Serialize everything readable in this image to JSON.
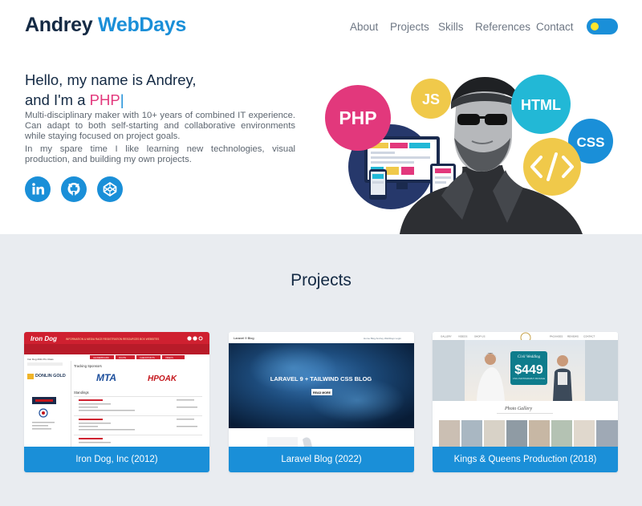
{
  "header": {
    "brand_first": "Andrey",
    "brand_second": "WebDays",
    "nav": [
      "About",
      "Projects",
      "Skills",
      "References",
      "Contact"
    ],
    "theme_toggle": "dark-mode-toggle"
  },
  "hero": {
    "line1": "Hello, my name is Andrey,",
    "line2_prefix": "and I'm a ",
    "line2_word": "PHP",
    "caret": "|",
    "para1": "Multi-disciplinary maker with 10+ years of combined IT experience. Can adapt to both self-starting and collaborative environments while staying focused on project goals.",
    "para2": "In my spare time I like learning new technologies, visual production, and building my own projects.",
    "social_icons": [
      "linkedin-icon",
      "github-icon",
      "codepen-icon"
    ],
    "bubbles": [
      "PHP",
      "JS",
      "HTML",
      "CSS"
    ]
  },
  "projects": {
    "title": "Projects",
    "items": [
      {
        "caption": "Iron Dog, Inc (2012)",
        "thumb": {
          "logo": "Iron Dog",
          "nav": "INFORMATION & MEDIA   RACE REGISTRATION RESOURCES   BOX WEBSITES",
          "tabs": [
            "LEADERBOARD",
            "ROUTE",
            "CHECKPOINTS",
            "VIDEOS"
          ],
          "side_title": "Iron Dog 2011 Pro Class",
          "sponsors_label": "Tracking Sponsors",
          "sponsor1": "MTA",
          "sponsor2": "HPOAK",
          "standings_label": "Standings",
          "left_logos": [
            "DONLIN GOLD"
          ]
        }
      },
      {
        "caption": "Laravel Blog (2022)",
        "thumb": {
          "site": "Laravel 9 Blog",
          "links": "Home   Blog   Andrey WebDays   Login",
          "banner": "LARAVEL 9 + TAILWIND CSS BLOG",
          "button": "READ MORE"
        }
      },
      {
        "caption": "Kings & Queens Production (2018)",
        "thumb": {
          "nav_left": [
            "GALLERY",
            "VIDEOS",
            "SHOP US"
          ],
          "nav_right": [
            "PACKAGES",
            "REVIEWS",
            "CONTACT"
          ],
          "script": "Civil Wedding",
          "price": "$449",
          "price_note": "CIVIL PHOTOGRAPHY PACKAGE",
          "gallery": "Photo Gallery"
        }
      }
    ]
  },
  "colors": {
    "accent": "#1a8fd8",
    "php_pink": "#e2387c",
    "navy": "#142a44",
    "bg": "#e9ecf0"
  }
}
